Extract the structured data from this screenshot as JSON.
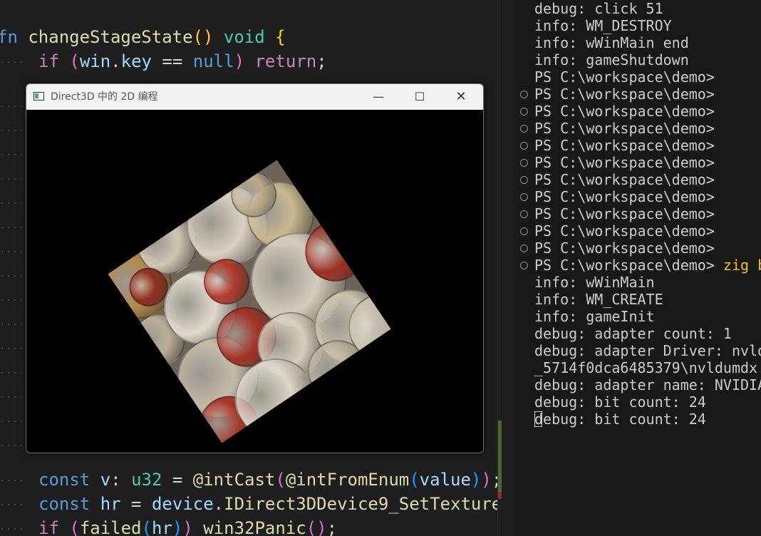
{
  "editor": {
    "line1": {
      "kw": "fn",
      "name": "changeStageState",
      "parens": "()",
      "ret": "void",
      "brace": "{"
    },
    "line2": {
      "if": "if",
      "open": "(",
      "var": "win",
      "dot": ".",
      "field": "key",
      "op": " == ",
      "null": "null",
      "close": ")",
      "ret": "return",
      "semi": ";"
    },
    "line3": {
      "kw": "const",
      "name": "v",
      "colon": ": ",
      "type": "u32",
      "eq": " = ",
      "f1": "@intCast",
      "o1": "(",
      "f2": "@intFromEnum",
      "o2": "(",
      "arg": "value",
      "c2": ")",
      "c1": ")",
      "semi": ";"
    },
    "line4": {
      "kw": "const",
      "name": "hr",
      "eq": " = ",
      "obj": "device",
      "dot": ".",
      "method": "IDirect3DDevice9_SetTexture"
    },
    "line5": {
      "if": "if",
      "open": "(",
      "fn": "failed",
      "o2": "(",
      "arg": "hr",
      "c2": ")",
      "c1": ")",
      "panic": "win32Panic",
      "call": "()",
      "semi": ";"
    }
  },
  "terminal": {
    "lines": [
      "debug: click 51",
      "info: WM_DESTROY",
      "info: wWinMain end",
      "info: gameShutdown",
      "PS C:\\workspace\\demo>",
      "PS C:\\workspace\\demo>",
      "PS C:\\workspace\\demo>",
      "PS C:\\workspace\\demo>",
      "PS C:\\workspace\\demo>",
      "PS C:\\workspace\\demo>",
      "PS C:\\workspace\\demo>",
      "PS C:\\workspace\\demo>",
      "PS C:\\workspace\\demo>",
      "PS C:\\workspace\\demo>",
      "PS C:\\workspace\\demo>",
      "info: wWinMain",
      "info: WM_CREATE",
      "info: gameInit",
      "debug: adapter count: 1",
      "debug: adapter Driver: nvld",
      "_5714f0dca6485379\\nvldumdx.",
      "debug: adapter name: NVIDIA",
      "debug: bit count: 24",
      "debug: bit count: 24"
    ],
    "last_cmd": "zig b"
  },
  "window": {
    "title": "Direct3D 中的 2D 编程",
    "min_label": "—",
    "max_label": "☐",
    "close_label": "✕",
    "icon": "app-window-icon"
  }
}
